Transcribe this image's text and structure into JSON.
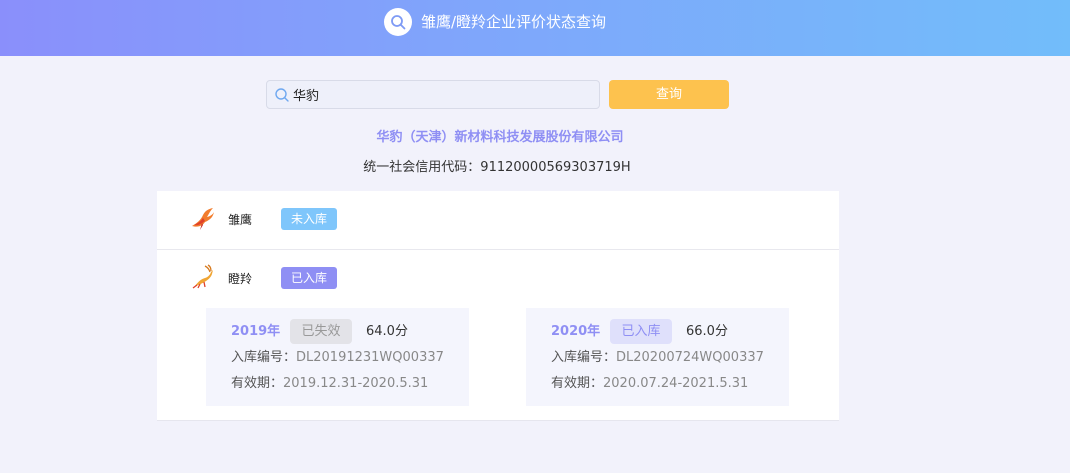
{
  "header": {
    "title": "雏鹰/瞪羚企业评价状态查询",
    "icon": "search-icon"
  },
  "search": {
    "value": "华豹",
    "placeholder": "",
    "button_label": "查询"
  },
  "company": {
    "name": "华豹（天津）新材料科技发展股份有限公司",
    "credit_code": "统一社会信用代码：91120000569303719H"
  },
  "rows": [
    {
      "label": "雏鹰",
      "icon": "eagle-icon",
      "badge": "未入库",
      "badge_color": "#7fc6fb"
    },
    {
      "label": "瞪羚",
      "icon": "gazelle-icon",
      "badge": "已入库",
      "badge_color": "#8f8ff4",
      "records": [
        {
          "year": "2019年",
          "status": "已失效",
          "score": "64.0分",
          "number_label": "入库编号：",
          "number": "DL20191231WQ00337",
          "validity_label": "有效期：",
          "validity": "2019.12.31-2020.5.31"
        },
        {
          "year": "2020年",
          "status": "已入库",
          "score": "66.0分",
          "number_label": "入库编号：",
          "number": "DL20200724WQ00337",
          "validity_label": "有效期：",
          "validity": "2020.07.24-2021.5.31"
        }
      ]
    }
  ],
  "colors": {
    "accent": "#8f8ff4",
    "button": "#fdc24e",
    "badge_blue": "#7fc6fb"
  }
}
